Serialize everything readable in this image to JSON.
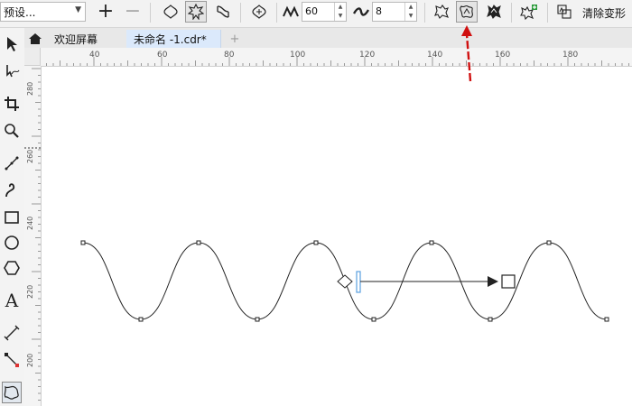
{
  "toolbar": {
    "preset_label": "预设...",
    "points": "60",
    "smoothness": "8",
    "clear_label": "清除变形"
  },
  "tabs": [
    {
      "label": "欢迎屏幕"
    },
    {
      "label": "未命名 -1.cdr*"
    }
  ],
  "ruler": {
    "h_labels": [
      "40",
      "60",
      "80",
      "100",
      "120",
      "140",
      "160",
      "180"
    ],
    "v_labels": [
      "280",
      "260",
      "240",
      "220",
      "200"
    ]
  },
  "colors": {
    "accent_tab": "#dbe9fb",
    "annotation_arrow": "#d01010",
    "handle_blue": "#5aa0e0"
  }
}
